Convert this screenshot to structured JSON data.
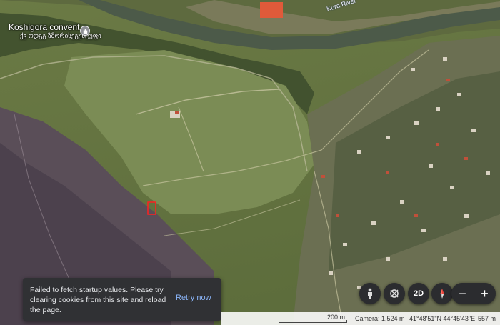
{
  "place": {
    "title": "Koshigora convent",
    "subtitle": "ქვ ოდგგ ზმორისეგუმტუფი",
    "icon": "monastery-pin-icon"
  },
  "river_label": "Kura River",
  "toast": {
    "message": "Failed to fetch startup values. Please try clearing cookies from this site and reload the page.",
    "action": "Retry now"
  },
  "controls": {
    "pegman_icon": "street-view-pegman-icon",
    "tilt_icon": "tilt-rotate-icon",
    "view_toggle": "2D",
    "compass_icon": "compass-icon",
    "zoom_out": "−",
    "zoom_in": "+"
  },
  "status_bar": {
    "scale": "200 m",
    "camera": "Camera: 1,524 m",
    "coordinates": "41°48'51\"N 44°45'43\"E",
    "elevation": "557 m"
  },
  "colors": {
    "toast_bg": "#303134",
    "toast_action": "#8ab4f8",
    "marker": "#ff2020"
  }
}
